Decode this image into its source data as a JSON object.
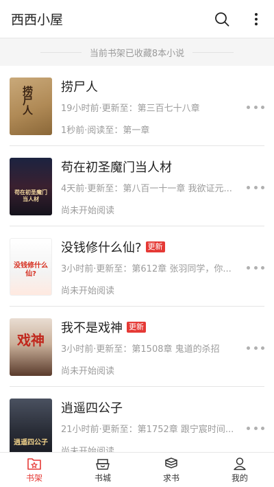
{
  "header": {
    "title": "西西小屋"
  },
  "banner": {
    "text": "当前书架已收藏8本小说"
  },
  "books": [
    {
      "title": "捞尸人",
      "update_badge": "",
      "meta": "19小时前·更新至：第三百七十八章",
      "progress": "1秒前·阅读至：第一章",
      "cover_text": "捞尸人"
    },
    {
      "title": "苟在初圣魔门当人材",
      "update_badge": "",
      "meta": "4天前·更新至：第八百一十一章 我欲证元...",
      "progress": "尚未开始阅读",
      "cover_text": "苟在初圣魔门当人材"
    },
    {
      "title": "没钱修什么仙?",
      "update_badge": "更新",
      "meta": "3小时前·更新至：第612章 张羽同学，你...",
      "progress": "尚未开始阅读",
      "cover_text": "没钱修什么仙?"
    },
    {
      "title": "我不是戏神",
      "update_badge": "更新",
      "meta": "3小时前·更新至：第1508章 鬼道的杀招",
      "progress": "尚未开始阅读",
      "cover_text": "戏神"
    },
    {
      "title": "逍遥四公子",
      "update_badge": "",
      "meta": "21小时前·更新至：第1752章  跟宁宸时间...",
      "progress": "尚未开始阅读",
      "cover_text": "逍遥四公子"
    }
  ],
  "tabs": [
    {
      "label": "书架",
      "icon": "bookshelf-icon"
    },
    {
      "label": "书城",
      "icon": "bookstore-icon"
    },
    {
      "label": "求书",
      "icon": "book-stack-icon"
    },
    {
      "label": "我的",
      "icon": "user-icon"
    }
  ],
  "colors": {
    "accent": "#e53935",
    "muted": "#9b9b9b"
  }
}
